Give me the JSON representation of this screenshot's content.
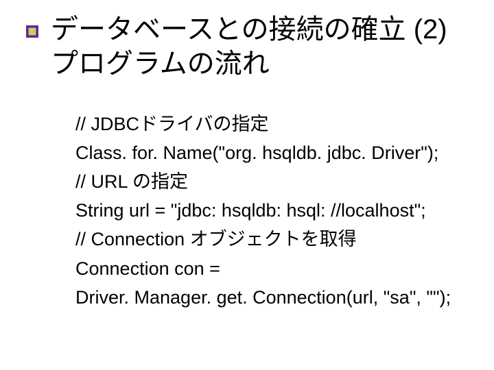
{
  "title": "データベースとの接続の確立 (2)\nプログラムの流れ",
  "body": {
    "lines": [
      "// JDBCドライバの指定",
      "Class. for. Name(\"org. hsqldb. jdbc. Driver\");",
      "// URL の指定",
      "String url = \"jdbc: hsqldb: hsql: //localhost\";",
      "// Connection オブジェクトを取得",
      "Connection con =",
      "Driver. Manager. get. Connection(url, \"sa\", \"\");"
    ]
  },
  "bullet_colors": {
    "outer": "#5b2e91",
    "inner": "#d4c968"
  }
}
